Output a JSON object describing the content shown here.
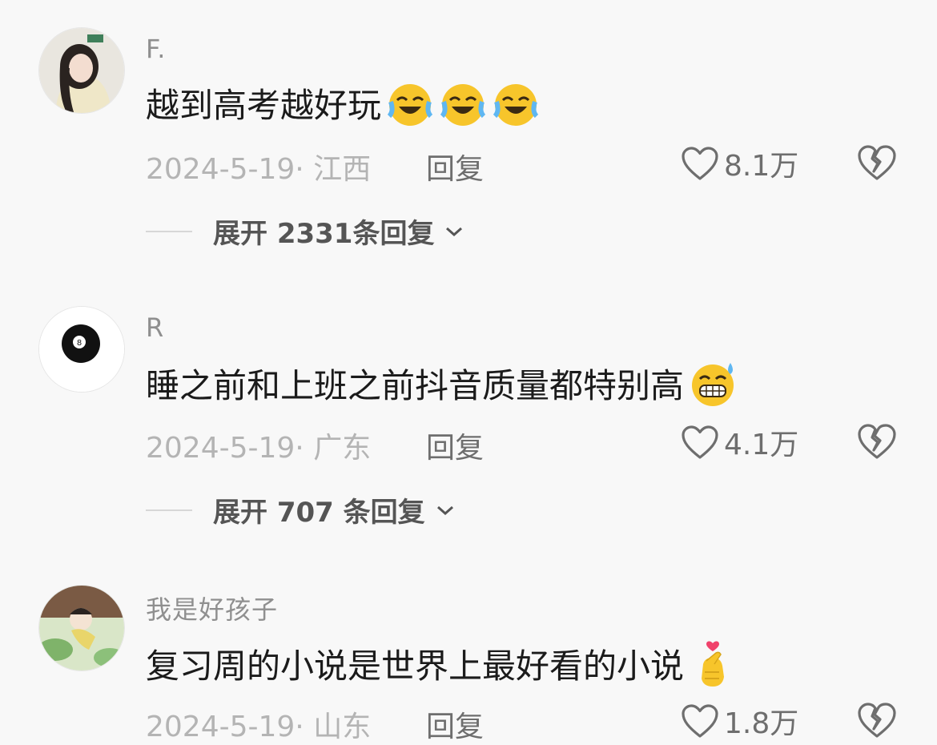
{
  "comments": [
    {
      "username": "F.",
      "text": "越到高考越好玩",
      "emojis": [
        "crying-laughing-emoji",
        "crying-laughing-emoji",
        "crying-laughing-emoji"
      ],
      "date_location": "2024-5-19· 江西",
      "reply_label": "回复",
      "likes": "8.1万",
      "expand_label": "展开 2331条回复",
      "avatar": "girl-photo-avatar"
    },
    {
      "username": "R",
      "text": "睡之前和上班之前抖音质量都特别高",
      "emojis": [
        "grimacing-sweat-emoji"
      ],
      "date_location": "2024-5-19· 广东",
      "reply_label": "回复",
      "likes": "4.1万",
      "expand_label": "展开 707 条回复",
      "avatar": "eight-ball-avatar"
    },
    {
      "username": "我是好孩子",
      "text": "复习周的小说是世界上最好看的小说",
      "emojis": [
        "finger-heart-emoji"
      ],
      "date_location": "2024-5-19· 山东",
      "reply_label": "回复",
      "likes": "1.8万",
      "avatar": "illustrated-child-avatar"
    }
  ],
  "colors": {
    "background": "#f8f8f8",
    "username": "#8f8f8f",
    "meta": "#b4b4b4",
    "action": "#6e6e6e"
  }
}
